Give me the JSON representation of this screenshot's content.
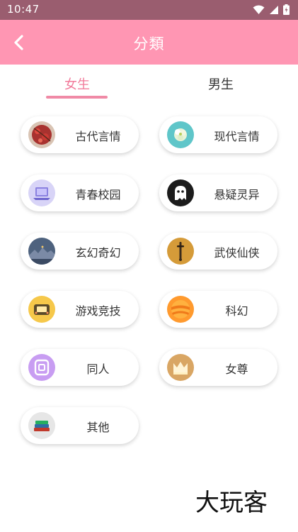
{
  "status_bar": {
    "time": "10:47"
  },
  "header": {
    "title": "分類"
  },
  "tabs": [
    {
      "label": "女生"
    },
    {
      "label": "男生"
    }
  ],
  "categories": [
    {
      "label": "古代言情",
      "icon": "red-cherry-blossom-icon"
    },
    {
      "label": "现代言情",
      "icon": "teal-flower-icon"
    },
    {
      "label": "青春校园",
      "icon": "laptop-icon"
    },
    {
      "label": "悬疑灵异",
      "icon": "ghost-icon"
    },
    {
      "label": "玄幻奇幻",
      "icon": "fantasy-landscape-icon"
    },
    {
      "label": "武侠仙侠",
      "icon": "sword-icon"
    },
    {
      "label": "游戏竞技",
      "icon": "game-console-icon"
    },
    {
      "label": "科幻",
      "icon": "orange-planet-icon"
    },
    {
      "label": "同人",
      "icon": "tongren-badge-icon"
    },
    {
      "label": "女尊",
      "icon": "crown-icon"
    },
    {
      "label": "其他",
      "icon": "books-icon"
    }
  ],
  "watermark": {
    "text": "大玩客"
  },
  "colors": {
    "status_bar": "#9a5d6f",
    "app_bar": "#ff96b3",
    "tab_active": "#f27b9b",
    "tab_indicator": "#f08aa6"
  }
}
